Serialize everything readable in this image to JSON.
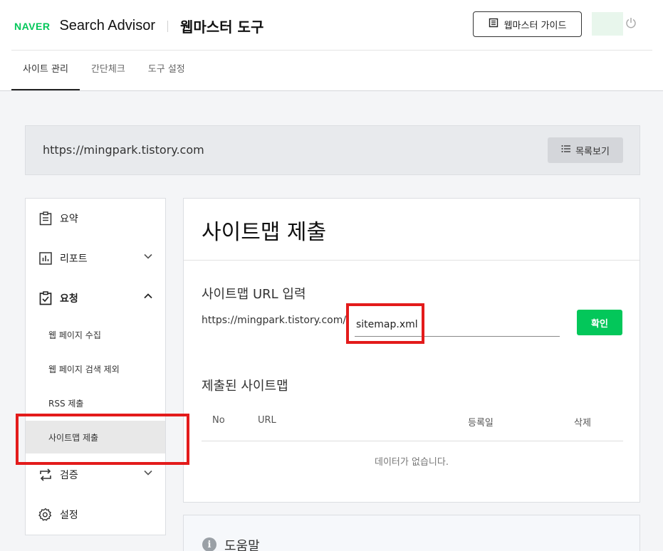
{
  "header": {
    "logo": "NAVER",
    "brand": "Search Advisor",
    "tool_title": "웹마스터 도구",
    "guide_button": "웹마스터 가이드"
  },
  "nav": {
    "tabs": [
      {
        "label": "사이트 관리",
        "active": true
      },
      {
        "label": "간단체크",
        "active": false
      },
      {
        "label": "도구 설정",
        "active": false
      }
    ]
  },
  "site": {
    "url": "https://mingpark.tistory.com",
    "list_button": "목록보기"
  },
  "sidebar": {
    "items": [
      {
        "label": "요약",
        "icon": "clipboard-icon"
      },
      {
        "label": "리포트",
        "icon": "chart-icon",
        "chevron": "down"
      },
      {
        "label": "요청",
        "icon": "clipboard-check-icon",
        "chevron": "up"
      },
      {
        "label": "검증",
        "icon": "repeat-icon",
        "chevron": "down"
      },
      {
        "label": "설정",
        "icon": "gear-icon"
      }
    ],
    "sub_items": [
      {
        "label": "웹 페이지 수집"
      },
      {
        "label": "웹 페이지 검색 제외"
      },
      {
        "label": "RSS 제출"
      },
      {
        "label": "사이트맵 제출",
        "active": true
      }
    ]
  },
  "main": {
    "title": "사이트맵 제출",
    "input_section_title": "사이트맵 URL 입력",
    "url_prefix": "https://mingpark.tistory.com/",
    "sitemap_value": "sitemap.xml",
    "confirm_button": "확인",
    "submitted_title": "제출된 사이트맵",
    "table_headers": [
      "No",
      "URL",
      "등록일",
      "삭제"
    ],
    "empty_text": "데이터가 없습니다."
  },
  "help": {
    "title": "도움말"
  },
  "colors": {
    "accent": "#03c75a",
    "highlight": "#e31b1b"
  }
}
